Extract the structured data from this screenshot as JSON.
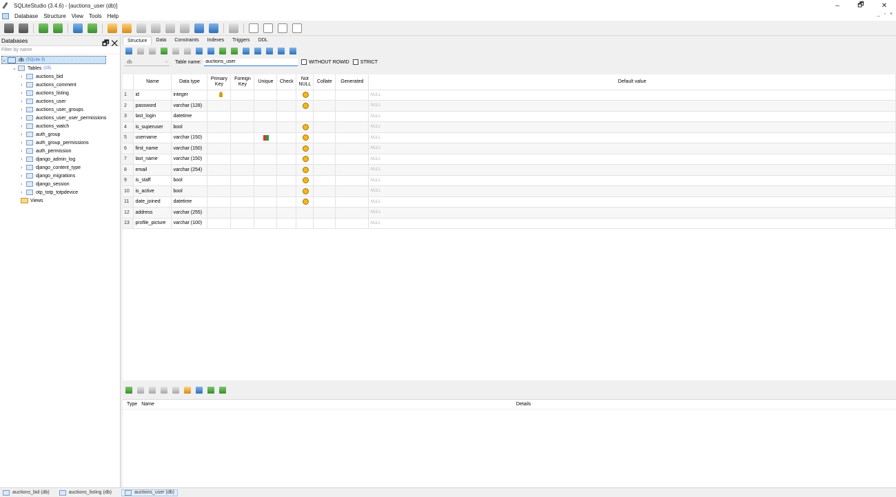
{
  "window": {
    "title": "SQLiteStudio (3.4.6) - [auctions_user (db)]",
    "controls": {
      "minimize": "–",
      "restore": "🗗",
      "close": "✕"
    },
    "mdi_controls": "_ ▫ ×"
  },
  "menu": [
    "Database",
    "Structure",
    "View",
    "Tools",
    "Help"
  ],
  "db_panel": {
    "title": "Databases",
    "header_buttons": "🗗 ✕",
    "filter_placeholder": "Filter by name",
    "db_name": "db",
    "db_hint": "(SQLite 3)",
    "tables_label": "Tables",
    "tables_count": "(15)",
    "tables": [
      "auctions_bid",
      "auctions_comment",
      "auctions_listing",
      "auctions_user",
      "auctions_user_groups",
      "auctions_user_user_permissions",
      "auctions_watch",
      "auth_group",
      "auth_group_permissions",
      "auth_permission",
      "django_admin_log",
      "django_content_type",
      "django_migrations",
      "django_session",
      "otp_totp_totpdevice"
    ],
    "views_label": "Views"
  },
  "editor": {
    "tabs": [
      "Structure",
      "Data",
      "Constraints",
      "Indexes",
      "Triggers",
      "DDL"
    ],
    "active_tab": "Structure",
    "db_select": "db",
    "table_name_label": "Table name:",
    "table_name": "auctions_user",
    "without_rowid": "WITHOUT ROWID",
    "strict": "STRICT"
  },
  "columns_header": {
    "name": "Name",
    "type": "Data type",
    "pk": "Primary Key",
    "fk": "Foreign Key",
    "unique": "Unique",
    "check": "Check",
    "not_null": "Not NULL",
    "collate": "Collate",
    "generated": "Generated",
    "default": "Default value"
  },
  "columns": [
    {
      "n": "1",
      "name": "id",
      "type": "integer",
      "pk": true,
      "unique": false,
      "nn": true,
      "default": "NULL"
    },
    {
      "n": "2",
      "name": "password",
      "type": "varchar (128)",
      "pk": false,
      "unique": false,
      "nn": true,
      "default": "NULL"
    },
    {
      "n": "3",
      "name": "last_login",
      "type": "datetime",
      "pk": false,
      "unique": false,
      "nn": false,
      "default": "NULL"
    },
    {
      "n": "4",
      "name": "is_superuser",
      "type": "bool",
      "pk": false,
      "unique": false,
      "nn": true,
      "default": "NULL"
    },
    {
      "n": "5",
      "name": "username",
      "type": "varchar (150)",
      "pk": false,
      "unique": true,
      "nn": true,
      "default": "NULL"
    },
    {
      "n": "6",
      "name": "first_name",
      "type": "varchar (150)",
      "pk": false,
      "unique": false,
      "nn": true,
      "default": "NULL"
    },
    {
      "n": "7",
      "name": "last_name",
      "type": "varchar (150)",
      "pk": false,
      "unique": false,
      "nn": true,
      "default": "NULL"
    },
    {
      "n": "8",
      "name": "email",
      "type": "varchar (254)",
      "pk": false,
      "unique": false,
      "nn": true,
      "default": "NULL"
    },
    {
      "n": "9",
      "name": "is_staff",
      "type": "bool",
      "pk": false,
      "unique": false,
      "nn": true,
      "default": "NULL"
    },
    {
      "n": "10",
      "name": "is_active",
      "type": "bool",
      "pk": false,
      "unique": false,
      "nn": true,
      "default": "NULL"
    },
    {
      "n": "11",
      "name": "date_joined",
      "type": "datetime",
      "pk": false,
      "unique": false,
      "nn": true,
      "default": "NULL"
    },
    {
      "n": "12",
      "name": "address",
      "type": "varchar (255)",
      "pk": false,
      "unique": false,
      "nn": false,
      "default": "NULL"
    },
    {
      "n": "13",
      "name": "profile_picture",
      "type": "varchar (100)",
      "pk": false,
      "unique": false,
      "nn": false,
      "default": "NULL"
    }
  ],
  "constraints_header": {
    "type": "Type",
    "name": "Name",
    "details": "Details"
  },
  "window_tabs": [
    {
      "label": "auctions_bid (db)",
      "active": false
    },
    {
      "label": "auctions_listing (db)",
      "active": false
    },
    {
      "label": "auctions_user (db)",
      "active": true
    }
  ]
}
